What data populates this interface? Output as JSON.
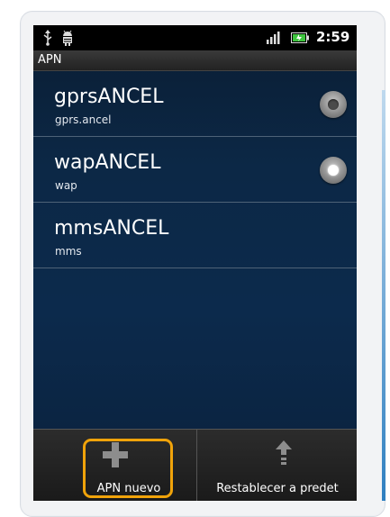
{
  "status_bar": {
    "time": "2:59",
    "icons": [
      "usb-icon",
      "android-debug-icon",
      "signal-icon",
      "battery-icon"
    ]
  },
  "header": {
    "title": "APN"
  },
  "apn_list": [
    {
      "name": "gprsANCEL",
      "subtitle": "gprs.ancel",
      "selected": false
    },
    {
      "name": "wapANCEL",
      "subtitle": "wap",
      "selected": true
    },
    {
      "name": "mmsANCEL",
      "subtitle": "mms",
      "selected": null
    }
  ],
  "menu": {
    "new_apn_label": "APN nuevo",
    "new_apn_icon": "plus-icon",
    "reset_label": "Restablecer a predet",
    "reset_icon": "upload-icon"
  },
  "colors": {
    "highlight": "#f0a30a",
    "background": "#0c2846"
  }
}
